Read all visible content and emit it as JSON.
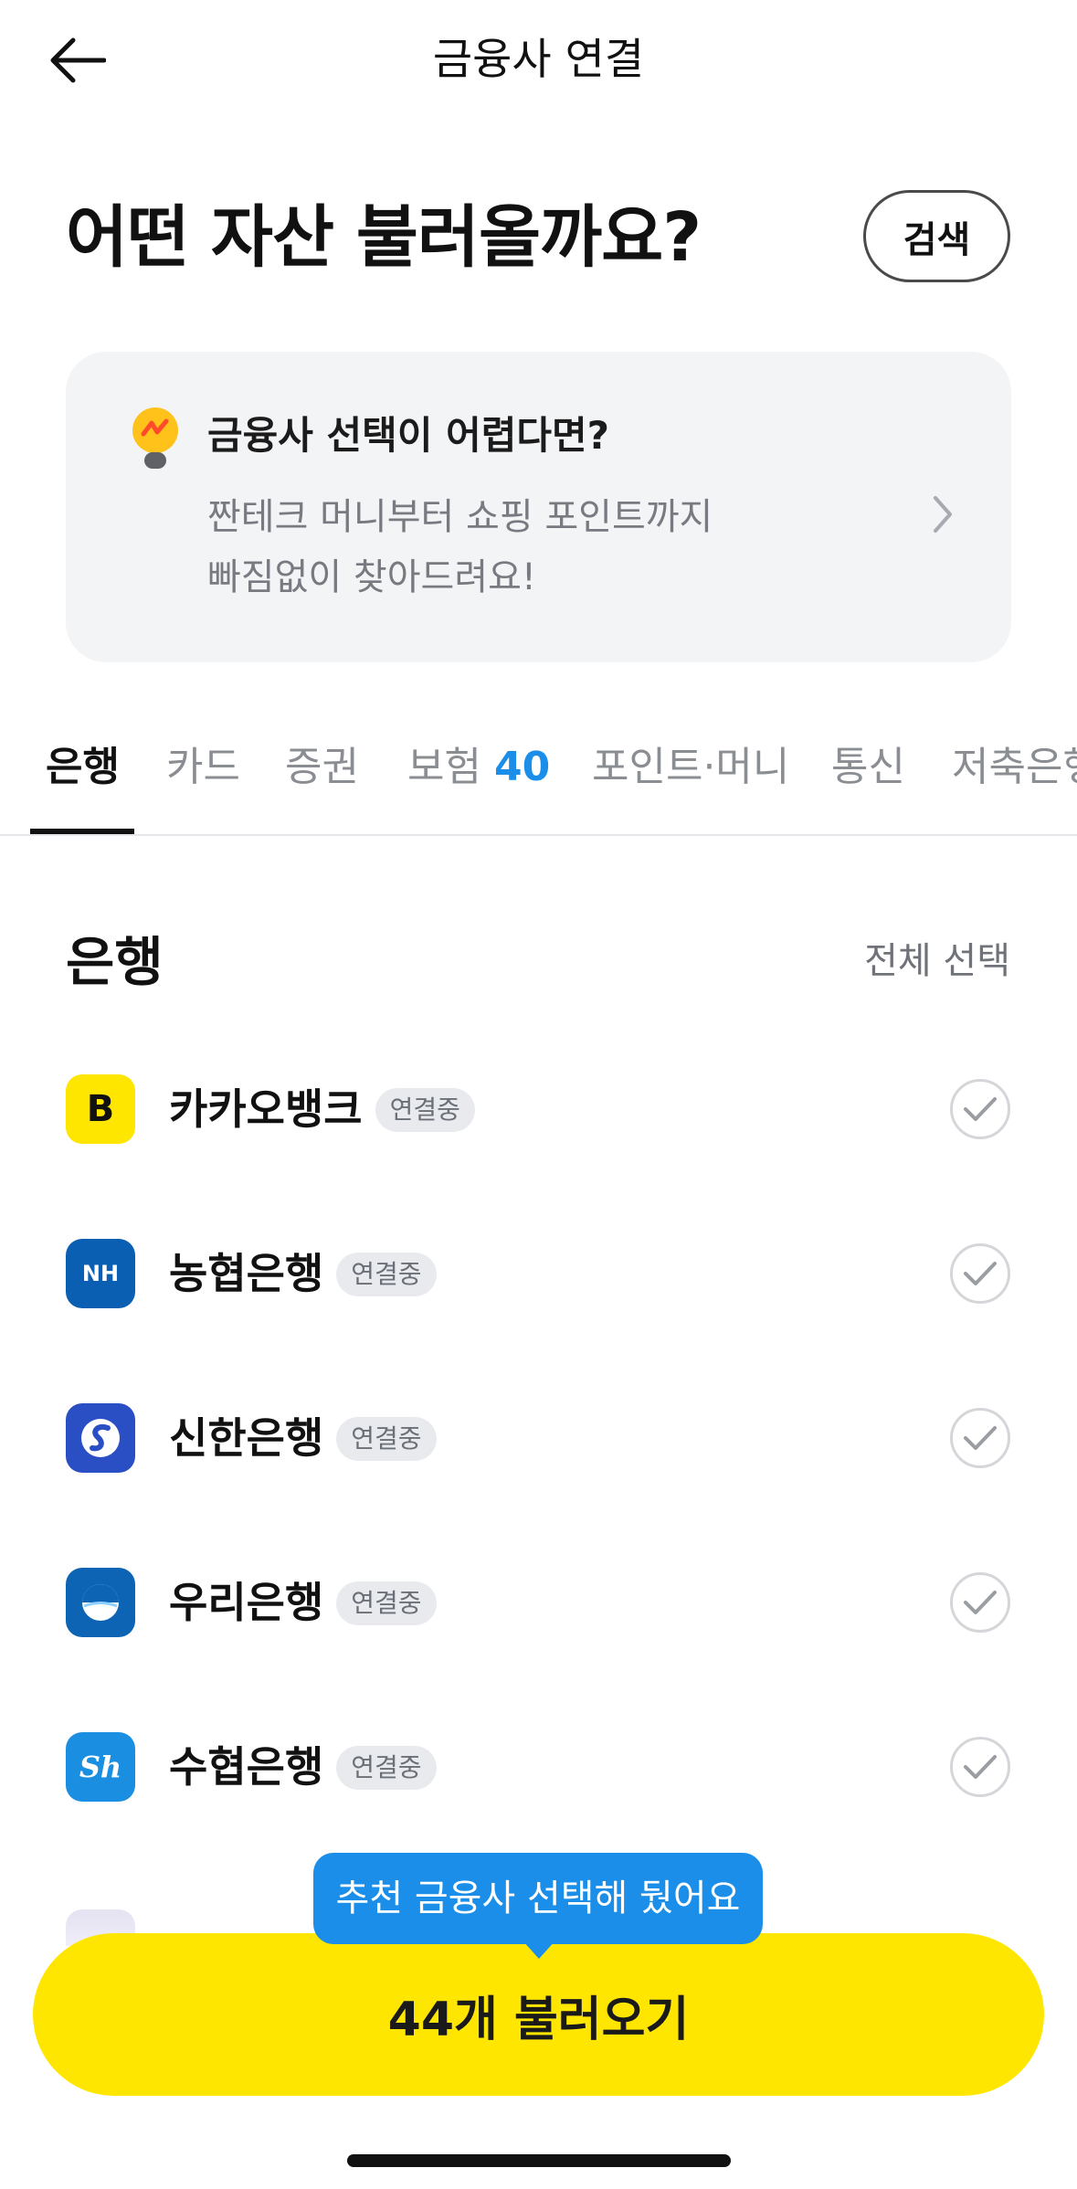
{
  "topbar": {
    "title": "금융사 연결",
    "back_icon": "arrow-left-icon"
  },
  "header": {
    "headline": "어떤 자산 불러올까요?",
    "search_label": "검색"
  },
  "tip": {
    "icon": "lightbulb-icon",
    "title": "금융사 선택이 어렵다면?",
    "desc_line1": "짠테크 머니부터 쇼핑 포인트까지",
    "desc_line2": "빠짐없이 찾아드려요!",
    "chevron_icon": "chevron-right-icon"
  },
  "tabs": [
    {
      "label": "은행",
      "active": true
    },
    {
      "label": "카드"
    },
    {
      "label": "증권"
    },
    {
      "label": "보험",
      "badge": "40"
    },
    {
      "label": "포인트·머니"
    },
    {
      "label": "통신"
    },
    {
      "label": "저축은행"
    }
  ],
  "section": {
    "title": "은행",
    "select_all": "전체 선택"
  },
  "banks": [
    {
      "name": "카카오뱅크",
      "status": "연결중",
      "logo_text": "B",
      "logo_color": "#ffe600"
    },
    {
      "name": "농협은행",
      "status": "연결중",
      "logo_text": "NH",
      "logo_color": "#0b5fb3"
    },
    {
      "name": "신한은행",
      "status": "연결중",
      "logo_text": "",
      "logo_color": "#2a4fc4"
    },
    {
      "name": "우리은행",
      "status": "연결중",
      "logo_text": "",
      "logo_color": "#0e64b4"
    },
    {
      "name": "수협은행",
      "status": "연결중",
      "logo_text": "Sh",
      "logo_color": "#1a8ee0"
    }
  ],
  "tooltip": {
    "text": "추천 금융사 선택해 뒀어요"
  },
  "cta": {
    "label": "44개 불러오기",
    "color": "#ffe600"
  }
}
